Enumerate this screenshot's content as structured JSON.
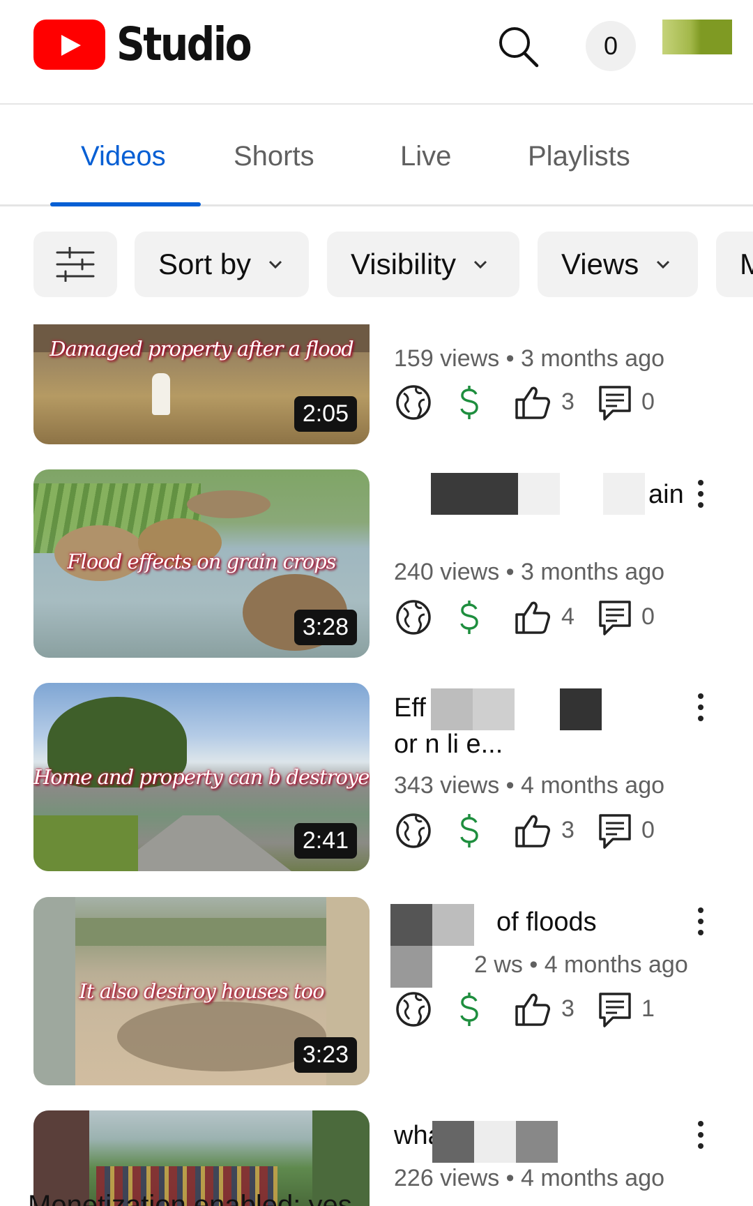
{
  "header": {
    "app_name": "Studio",
    "notification_count": "0",
    "icons": {
      "logo": "youtube-logo-icon",
      "search": "search-icon",
      "avatar": "account-avatar"
    }
  },
  "tabs": [
    {
      "label": "Videos",
      "active": true
    },
    {
      "label": "Shorts",
      "active": false
    },
    {
      "label": "Live",
      "active": false
    },
    {
      "label": "Playlists",
      "active": false
    }
  ],
  "filters": {
    "filter_icon": "filter-sliders-icon",
    "chips": [
      {
        "label": "Sort by"
      },
      {
        "label": "Visibility"
      },
      {
        "label": "Views"
      },
      {
        "label": "M"
      }
    ]
  },
  "videos": [
    {
      "thumb_caption": "Damaged property after a flood",
      "duration": "2:05",
      "title": "",
      "meta": "159 views • 3 months ago",
      "likes": "3",
      "comments": "0"
    },
    {
      "thumb_caption": "Flood effects on grain crops",
      "duration": "3:28",
      "title": "ain",
      "meta": "240 views • 3 months ago",
      "likes": "4",
      "comments": "0"
    },
    {
      "thumb_caption": "Home and property can b destroyed",
      "duration": "2:41",
      "title_line1": "Eff of fl",
      "title_line2": "or n li e...",
      "meta": "343 views • 4 months ago",
      "likes": "3",
      "comments": "0"
    },
    {
      "thumb_caption": "It also destroy houses too",
      "duration": "3:23",
      "title": "of floods",
      "meta": "2 ws • 4 months ago",
      "likes": "3",
      "comments": "1"
    },
    {
      "title": "wha",
      "meta": "226 views • 4 months ago"
    }
  ],
  "bottom_text": "Monetization enabled: yes",
  "colors": {
    "accent": "#065fd4",
    "monetization_green": "#1e8e3e",
    "youtube_red": "#ff0000"
  }
}
